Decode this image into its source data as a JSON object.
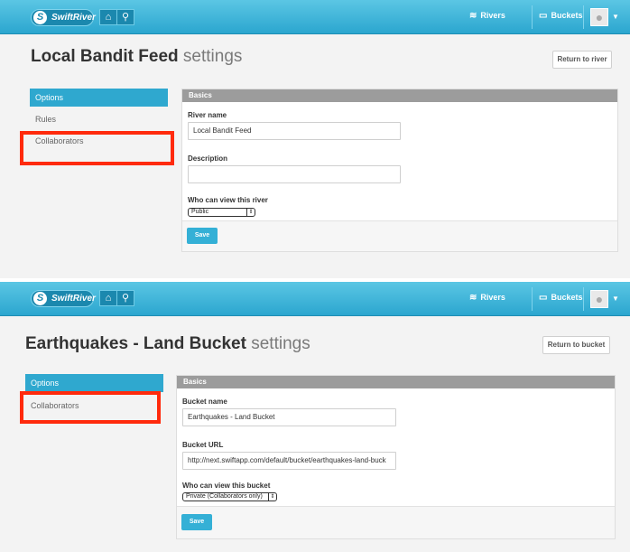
{
  "river": {
    "brand": "SwiftRiver",
    "nav": {
      "rivers": "Rivers",
      "buckets": "Buckets"
    },
    "title_bold": "Local Bandit Feed",
    "title_light": "settings",
    "return_label": "Return to river",
    "sidebar": [
      "Options",
      "Rules",
      "Collaborators"
    ],
    "section_header": "Basics",
    "name_label": "River name",
    "name_value": "Local Bandit Feed",
    "description_label": "Description",
    "description_value": "",
    "visibility_label": "Who can view this river",
    "visibility_value": "Public",
    "save_label": "Save"
  },
  "bucket": {
    "brand": "SwiftRiver",
    "nav": {
      "rivers": "Rivers",
      "buckets": "Buckets"
    },
    "title_bold": "Earthquakes - Land Bucket",
    "title_light": "settings",
    "return_label": "Return to bucket",
    "sidebar": [
      "Options",
      "Collaborators"
    ],
    "section_header": "Basics",
    "name_label": "Bucket name",
    "name_value": "Earthquakes - Land Bucket",
    "url_label": "Bucket URL",
    "url_value": "http://next.swiftapp.com/default/bucket/earthquakes-land-buck",
    "visibility_label": "Who can view this bucket",
    "visibility_value": "Private (Collaborators only)",
    "save_label": "Save"
  },
  "colors": {
    "topbar": "#2ba6cf",
    "accent": "#2fa8cf",
    "highlight": "#ff2a0c",
    "section_header": "#9c9c9c"
  }
}
